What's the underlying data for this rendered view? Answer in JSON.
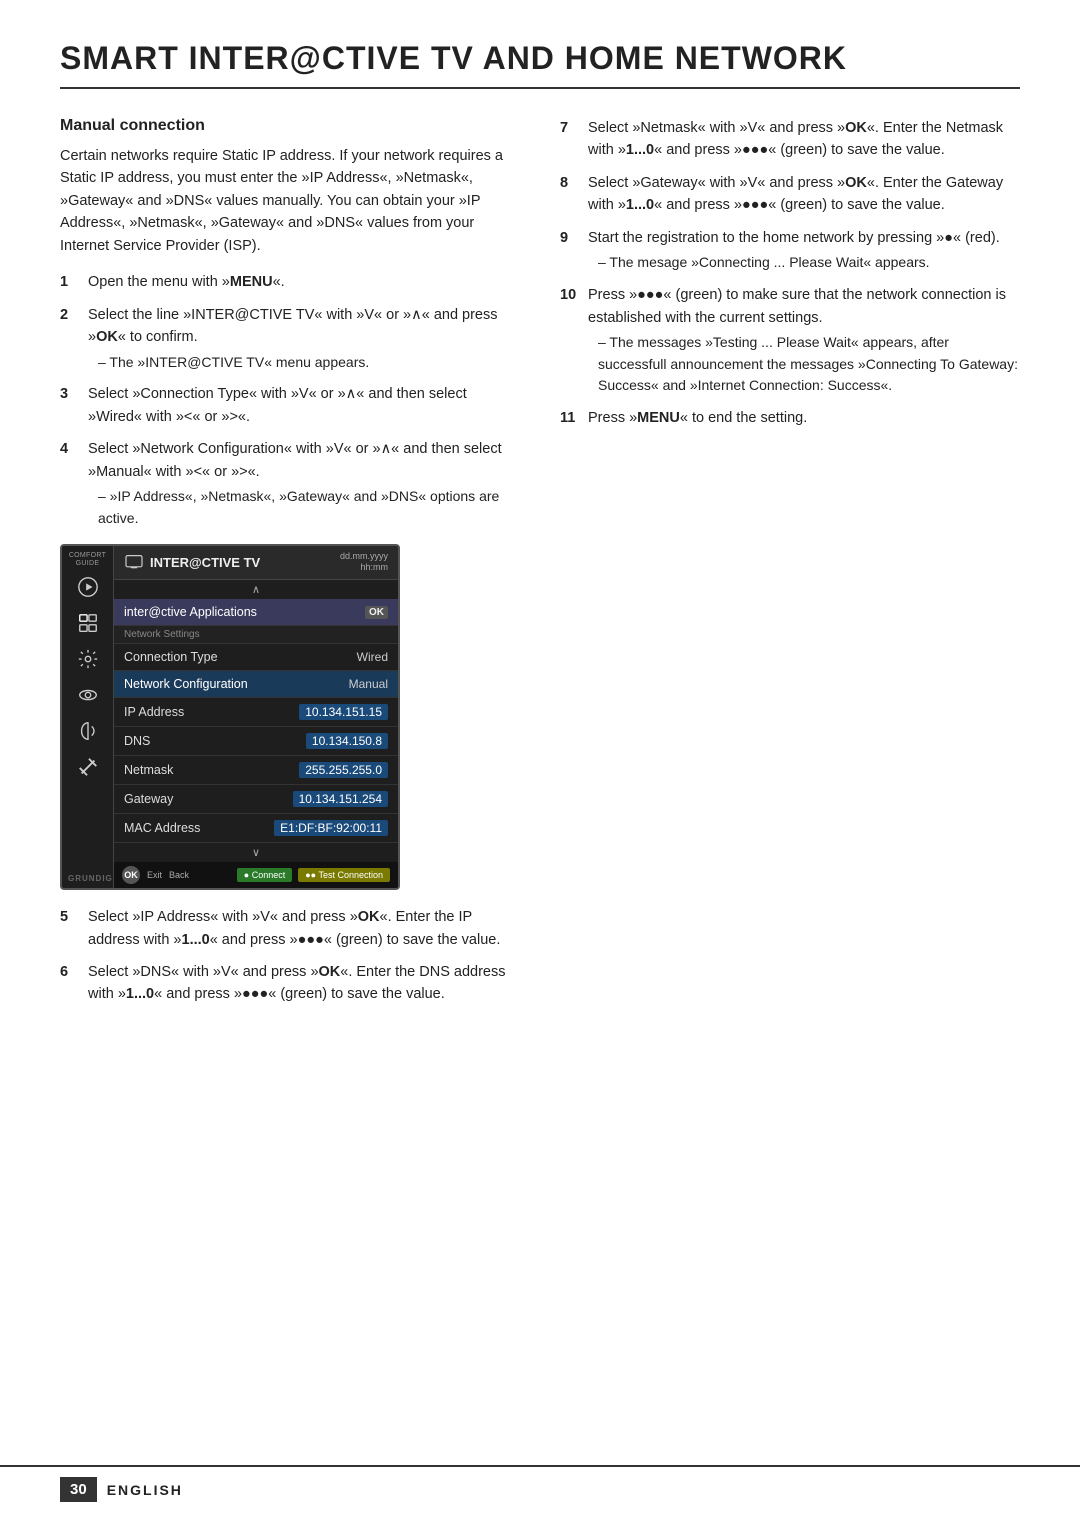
{
  "page": {
    "title": "SMART INTER@CTIVE TV AND HOME NETWORK",
    "footer": {
      "page_number": "30",
      "label": "ENGLISH"
    }
  },
  "left_col": {
    "section_heading": "Manual connection",
    "intro_text": "Certain networks require Static IP address. If your network requires a Static IP address, you must enter the »IP Address«, »Netmask«, »Gateway« and »DNS« values manually. You can obtain your »IP Address«, »Netmask«, »Gateway« and »DNS« values from your Internet Service Provider (ISP).",
    "steps": [
      {
        "num": "1",
        "text": "Open the menu with »MENU«.",
        "bold_parts": [
          "MENU"
        ]
      },
      {
        "num": "2",
        "text": "Select the line »INTER@CTIVE TV« with »V« or »∧« and press »OK« to confirm.",
        "sub": "– The »INTER@CTIVE TV« menu appears."
      },
      {
        "num": "3",
        "text": "Select »Connection Type« with »V« or »∧« and then select »Wired« with »<« or »>«."
      },
      {
        "num": "4",
        "text": "Select »Network Configuration« with »V« or »∧« and then select »Manual« with »<« or »>«.",
        "sub": "– »IP Address«, »Netmask«, »Gateway« and »DNS« options are active."
      }
    ],
    "steps_bottom": [
      {
        "num": "5",
        "text": "Select »IP Address« with »V« and press »OK«. Enter the IP address with »1...0« and press »●●●« (green) to save the value."
      },
      {
        "num": "6",
        "text": "Select »DNS« with »V« and press »OK«. Enter the DNS address with »1...0« and press »●●●« (green) to save the value."
      }
    ]
  },
  "tv_screen": {
    "header_text": "INTER@CTIVE TV",
    "date_label": "dd.mm.yyyy",
    "time_label": "hh:mm",
    "comfort_guide_label": "COMFORT\nGUIDE",
    "menu_arrow_up": "∧",
    "menu_arrow_down": "∨",
    "highlighted_item": "inter@ctive Applications",
    "ok_badge": "OK",
    "section_label": "Network Settings",
    "rows": [
      {
        "label": "Connection Type",
        "value": "Wired",
        "highlighted": false
      },
      {
        "label": "Network Configuration",
        "value": "Manual",
        "highlighted": true
      },
      {
        "label": "IP Address",
        "value": "10.134.151.15",
        "highlighted": false
      },
      {
        "label": "DNS",
        "value": "10.134.150.8",
        "highlighted": false
      },
      {
        "label": "Netmask",
        "value": "255.255.255.0",
        "highlighted": false
      },
      {
        "label": "Gateway",
        "value": "10.134.151.254",
        "highlighted": false
      },
      {
        "label": "MAC Address",
        "value": "E1:DF:BF:92:00:11",
        "highlighted": false
      }
    ],
    "footer": {
      "ok_label": "OK",
      "exit_label": "Exit",
      "back_label": "Back",
      "connect_btn": "● Connect",
      "test_conn_btn": "●● Test Connection"
    },
    "grundig_label": "GRUNDIG",
    "sidebar_icons": [
      "comfort_guide",
      "play",
      "interactive",
      "settings",
      "eye",
      "audio",
      "tools"
    ]
  },
  "right_col": {
    "steps": [
      {
        "num": "7",
        "text": "Select »Netmask« with »V« and press »OK«. Enter the Netmask with »1...0« and press »●●●« (green) to save the value."
      },
      {
        "num": "8",
        "text": "Select »Gateway« with »V« and press »OK«. Enter the Gateway with »1...0« and press »●●●« (green) to save the value."
      },
      {
        "num": "9",
        "text": "Start the registration to the home network by pressing »●« (red).",
        "sub": "– The mesage »Connecting ... Please Wait« appears."
      },
      {
        "num": "10",
        "text": "Press »●●●« (green) to make sure that the network connection is established with the current settings.",
        "sub": "– The messages »Testing ... Please Wait« appears, after successfull announcement the messages »Connecting To Gateway: Success« and »Internet Connection: Success«."
      },
      {
        "num": "11",
        "text": "Press »MENU« to end the setting.",
        "bold_parts": [
          "MENU"
        ]
      }
    ]
  }
}
